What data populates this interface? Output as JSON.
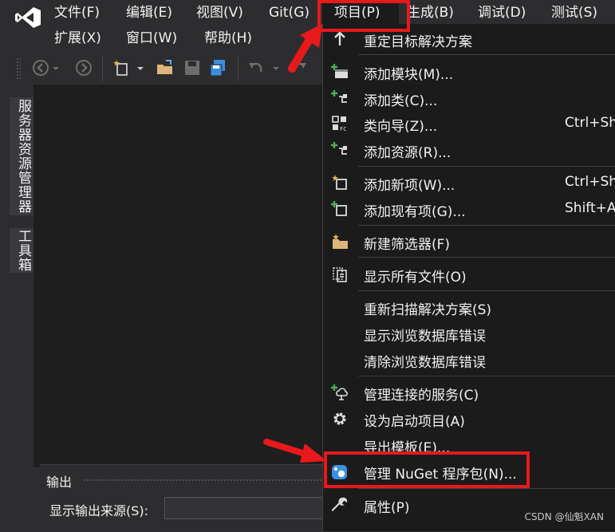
{
  "menubar": {
    "row1": [
      "文件(F)",
      "编辑(E)",
      "视图(V)",
      "Git(G)",
      "项目(P)",
      "生成(B)",
      "调试(D)",
      "测试(S)"
    ],
    "row2": [
      "扩展(X)",
      "窗口(W)",
      "帮助(H)"
    ]
  },
  "side_tabs": {
    "server_explorer": "服务器资源管理器",
    "toolbox": "工具箱"
  },
  "output": {
    "title": "输出",
    "source_label": "显示输出来源(S):",
    "source_value": ""
  },
  "project_menu": {
    "items": [
      {
        "label": "重定目标解决方案",
        "shortcut": "",
        "icon": "arrow-up-icon"
      },
      {
        "label": "添加模块(M)...",
        "shortcut": "",
        "icon": "add-module-icon"
      },
      {
        "label": "添加类(C)...",
        "shortcut": "",
        "icon": "add-class-icon"
      },
      {
        "label": "类向导(Z)...",
        "shortcut": "Ctrl+Sh",
        "icon": "class-wizard-icon"
      },
      {
        "label": "添加资源(R)...",
        "shortcut": "",
        "icon": "add-resource-icon"
      },
      {
        "label": "添加新项(W)...",
        "shortcut": "Ctrl+Sh",
        "icon": "add-new-item-icon"
      },
      {
        "label": "添加现有项(G)...",
        "shortcut": "Shift+A",
        "icon": "add-existing-item-icon"
      },
      {
        "label": "新建筛选器(F)",
        "shortcut": "",
        "icon": "new-filter-icon"
      },
      {
        "label": "显示所有文件(O)",
        "shortcut": "",
        "icon": "show-all-files-icon"
      },
      {
        "label": "重新扫描解决方案(S)",
        "shortcut": "",
        "icon": ""
      },
      {
        "label": "显示浏览数据库错误",
        "shortcut": "",
        "icon": ""
      },
      {
        "label": "清除浏览数据库错误",
        "shortcut": "",
        "icon": ""
      },
      {
        "label": "管理连接的服务(C)",
        "shortcut": "",
        "icon": "connected-services-icon"
      },
      {
        "label": "设为启动项目(A)",
        "shortcut": "",
        "icon": "gear-icon"
      },
      {
        "label": "导出模板(E)...",
        "shortcut": "",
        "icon": ""
      },
      {
        "label": "管理 NuGet 程序包(N)...",
        "shortcut": "",
        "icon": "nuget-icon"
      },
      {
        "label": "属性(P)",
        "shortcut": "",
        "icon": "wrench-icon"
      }
    ]
  },
  "watermark": "CSDN @仙魁XAN",
  "colors": {
    "highlight_red": "#e8191b",
    "menu_bg": "#1b1b1c",
    "chrome_bg": "#2d2d30"
  }
}
